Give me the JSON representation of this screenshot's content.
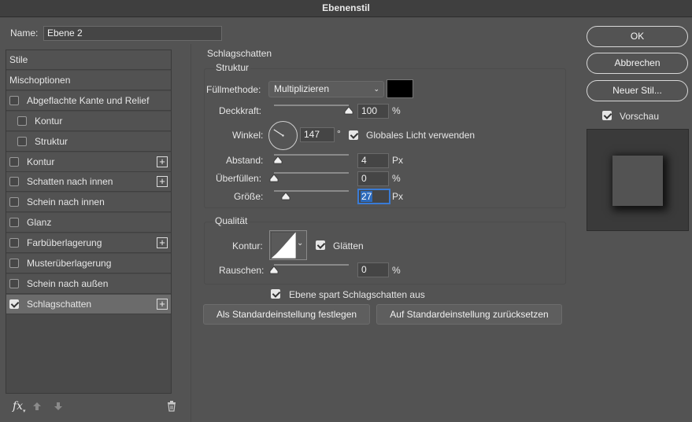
{
  "window": {
    "title": "Ebenenstil"
  },
  "name_field": {
    "label": "Name:",
    "value": "Ebene 2"
  },
  "styles_list": [
    {
      "label": "Stile",
      "checkbox": false,
      "checked": false,
      "plus": false,
      "indent": false,
      "selected": false
    },
    {
      "label": "Mischoptionen",
      "checkbox": false,
      "checked": false,
      "plus": false,
      "indent": false,
      "selected": false
    },
    {
      "label": "Abgeflachte Kante und Relief",
      "checkbox": true,
      "checked": false,
      "plus": false,
      "indent": false,
      "selected": false
    },
    {
      "label": "Kontur",
      "checkbox": true,
      "checked": false,
      "plus": false,
      "indent": true,
      "selected": false
    },
    {
      "label": "Struktur",
      "checkbox": true,
      "checked": false,
      "plus": false,
      "indent": true,
      "selected": false
    },
    {
      "label": "Kontur",
      "checkbox": true,
      "checked": false,
      "plus": true,
      "indent": false,
      "selected": false
    },
    {
      "label": "Schatten nach innen",
      "checkbox": true,
      "checked": false,
      "plus": true,
      "indent": false,
      "selected": false
    },
    {
      "label": "Schein nach innen",
      "checkbox": true,
      "checked": false,
      "plus": false,
      "indent": false,
      "selected": false
    },
    {
      "label": "Glanz",
      "checkbox": true,
      "checked": false,
      "plus": false,
      "indent": false,
      "selected": false
    },
    {
      "label": "Farbüberlagerung",
      "checkbox": true,
      "checked": false,
      "plus": true,
      "indent": false,
      "selected": false
    },
    {
      "label": "Musterüberlagerung",
      "checkbox": true,
      "checked": false,
      "plus": false,
      "indent": false,
      "selected": false
    },
    {
      "label": "Schein nach außen",
      "checkbox": true,
      "checked": false,
      "plus": false,
      "indent": false,
      "selected": false
    },
    {
      "label": "Schlagschatten",
      "checkbox": true,
      "checked": true,
      "plus": true,
      "indent": false,
      "selected": true
    }
  ],
  "bottom_toolbar": {
    "fx": "fx",
    "up_icon": "up-arrow-icon",
    "down_icon": "down-arrow-icon",
    "trash_icon": "trash-icon"
  },
  "drop_shadow": {
    "section_title": "Schlagschatten",
    "structure": {
      "title": "Struktur",
      "blend_mode_label": "Füllmethode:",
      "blend_mode_value": "Multiplizieren",
      "shadow_color": "#000000",
      "opacity_label": "Deckkraft:",
      "opacity_value": "100",
      "opacity_unit": "%",
      "opacity_level": 1.0,
      "angle_label": "Winkel:",
      "angle_value": "147",
      "angle_unit": "°",
      "global_light_label": "Globales Licht verwenden",
      "global_light_checked": true,
      "distance_label": "Abstand:",
      "distance_value": "4",
      "distance_unit": "Px",
      "distance_level": 0.02,
      "spread_label": "Überfüllen:",
      "spread_value": "0",
      "spread_unit": "%",
      "spread_level": 0.0,
      "size_label": "Größe:",
      "size_value": "27",
      "size_unit": "Px",
      "size_level": 0.11
    },
    "quality": {
      "title": "Qualität",
      "contour_label": "Kontur:",
      "antialias_label": "Glätten",
      "antialias_checked": true,
      "noise_label": "Rauschen:",
      "noise_value": "0",
      "noise_unit": "%",
      "noise_level": 0.0
    },
    "knockout_label": "Ebene spart Schlagschatten aus",
    "knockout_checked": true,
    "make_default_label": "Als Standardeinstellung festlegen",
    "reset_default_label": "Auf Standardeinstellung zurücksetzen"
  },
  "buttons": {
    "ok": "OK",
    "cancel": "Abbrechen",
    "new_style": "Neuer Stil..."
  },
  "preview": {
    "label": "Vorschau",
    "checked": true
  },
  "colors": {
    "accent": "#2d6bbd",
    "selection": "#6b6b6b"
  }
}
